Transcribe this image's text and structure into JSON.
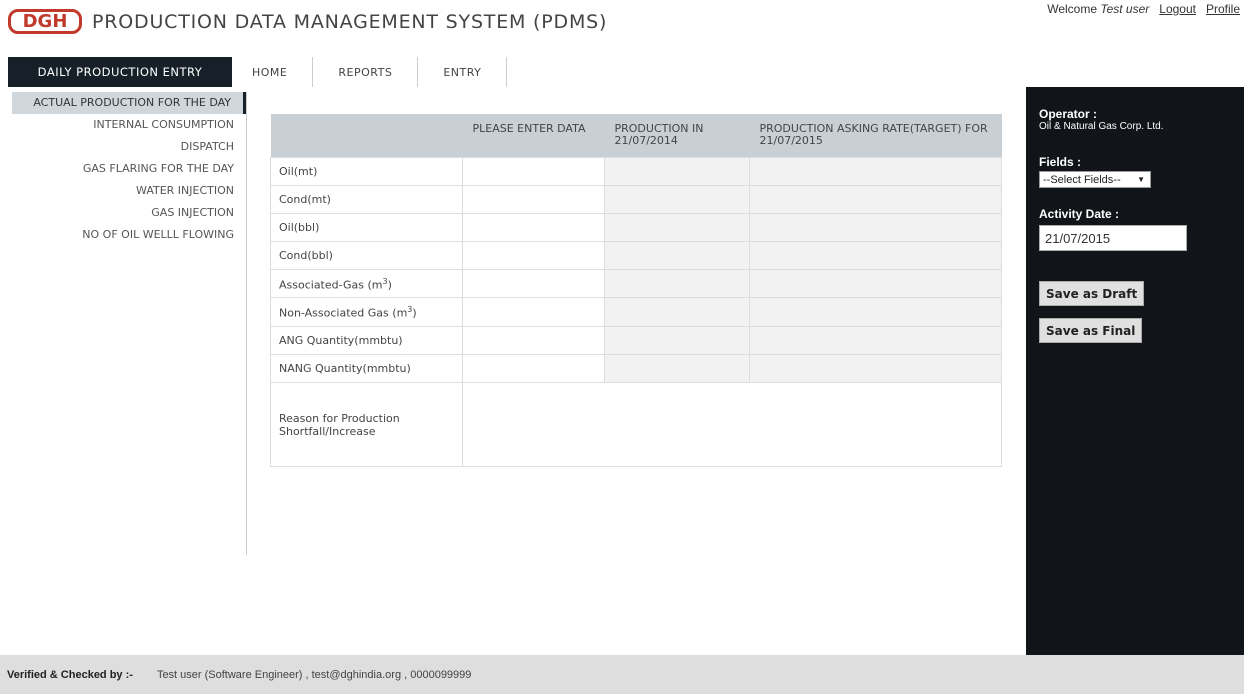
{
  "header": {
    "logo_text": "DGH",
    "title": "PRODUCTION DATA MANAGEMENT SYSTEM (PDMS)",
    "welcome": "Welcome",
    "user": "Test user",
    "logout": "Logout",
    "profile": "Profile"
  },
  "nav": {
    "active": "DAILY PRODUCTION ENTRY",
    "tabs": [
      "HOME",
      "REPORTS",
      "ENTRY"
    ]
  },
  "sidebar": {
    "items": [
      "ACTUAL PRODUCTION FOR THE DAY",
      "INTERNAL CONSUMPTION",
      "DISPATCH",
      "GAS FLARING FOR THE DAY",
      "WATER INJECTION",
      "GAS INJECTION",
      "NO OF OIL WELLL FLOWING"
    ]
  },
  "table": {
    "headers": [
      "",
      "PLEASE ENTER DATA",
      "PRODUCTION IN 21/07/2014",
      "PRODUCTION ASKING RATE(TARGET) FOR 21/07/2015"
    ],
    "rows": [
      "Oil(mt)",
      "Cond(mt)",
      "Oil(bbl)",
      "Cond(bbl)",
      "Associated-Gas (m",
      "Non-Associated Gas (m",
      "ANG Quantity(mmbtu)",
      "NANG Quantity(mmbtu)"
    ],
    "superscript": "3",
    "reason_label": "Reason for Production Shortfall/Increase"
  },
  "panel": {
    "operator_label": "Operator :",
    "operator_value": "Oil & Natural Gas Corp. Ltd.",
    "fields_label": "Fields :",
    "fields_selected": "--Select Fields--",
    "date_label": "Activity Date :",
    "date_value": "21/07/2015",
    "save_draft": "Save as Draft",
    "save_final": "Save as Final"
  },
  "footer": {
    "label": "Verified & Checked by :-",
    "value": "Test user (Software Engineer) , test@dghindia.org , 0000099999"
  }
}
